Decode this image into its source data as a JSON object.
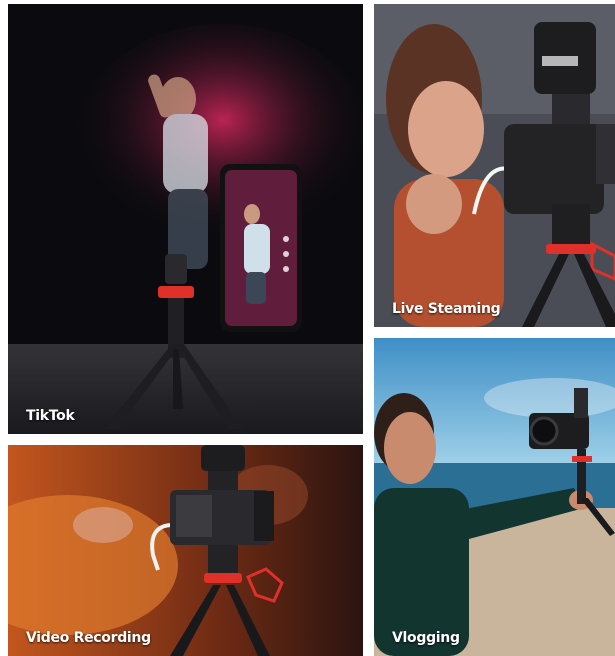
{
  "tiles": {
    "tiktok": {
      "caption": "TikTok"
    },
    "live": {
      "caption": "Live Steaming"
    },
    "video": {
      "caption": "Video Recording"
    },
    "vlog": {
      "caption": "Vlogging"
    }
  },
  "colors": {
    "accent": "#e0302a",
    "background": "#ffffff"
  },
  "icons": [
    "phone-icon",
    "tripod-icon",
    "camera-icon"
  ]
}
